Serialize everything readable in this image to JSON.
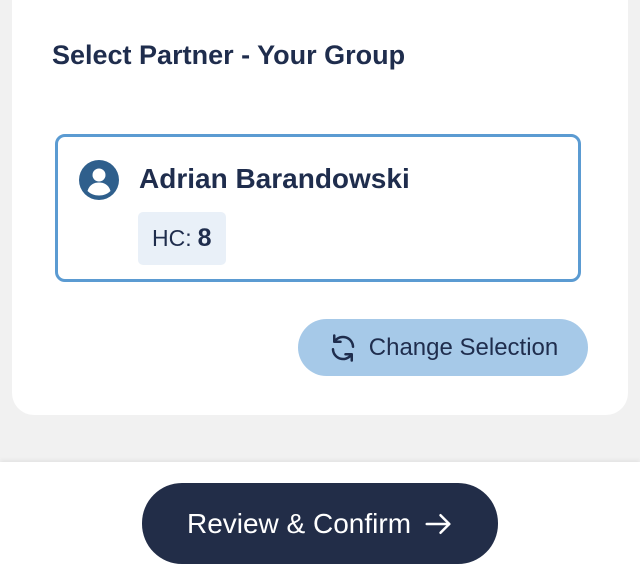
{
  "card": {
    "title": "Select Partner - Your Group"
  },
  "partner": {
    "name": "Adrian Barandowski",
    "hc_label": "HC:",
    "hc_value": "8",
    "avatar_icon": "person-circle-icon"
  },
  "change_selection": {
    "label": "Change Selection",
    "icon": "refresh-icon"
  },
  "footer": {
    "review_label": "Review & Confirm",
    "review_icon": "arrow-right-icon"
  },
  "colors": {
    "primary_text": "#1f2d4d",
    "partner_border": "#5b9bd2",
    "hc_badge_bg": "#e9f0f8",
    "change_button_bg": "#a6c9e8",
    "review_button_bg": "#222d48",
    "page_bg": "#f1f1f1",
    "card_bg": "#ffffff"
  }
}
